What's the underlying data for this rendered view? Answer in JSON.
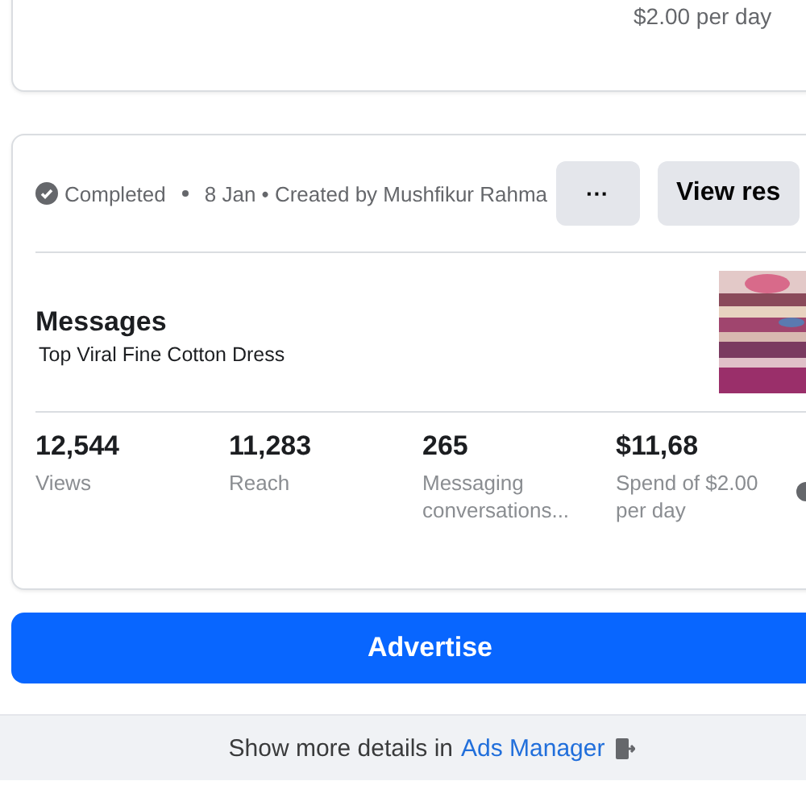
{
  "previous_card": {
    "spend_note": "$2.00 per day"
  },
  "campaign": {
    "status": "Completed",
    "status_done": true,
    "date": "8 Jan",
    "created_by": "• Created by Mushfikur Rahma",
    "more_button": "···",
    "view_button": "View res",
    "title": "Messages",
    "subtitle": "Top Viral Fine Cotton Dress",
    "stats": [
      {
        "value": "12,544",
        "label": "Views"
      },
      {
        "value": "11,283",
        "label": "Reach"
      },
      {
        "value": "265",
        "label": "Messaging conversations..."
      },
      {
        "value": "$11,68",
        "label": "Spend of $2.00 per day"
      }
    ]
  },
  "advertise_button": "Advertise",
  "footer": {
    "text": "Show more details in",
    "link": "Ads Manager"
  }
}
